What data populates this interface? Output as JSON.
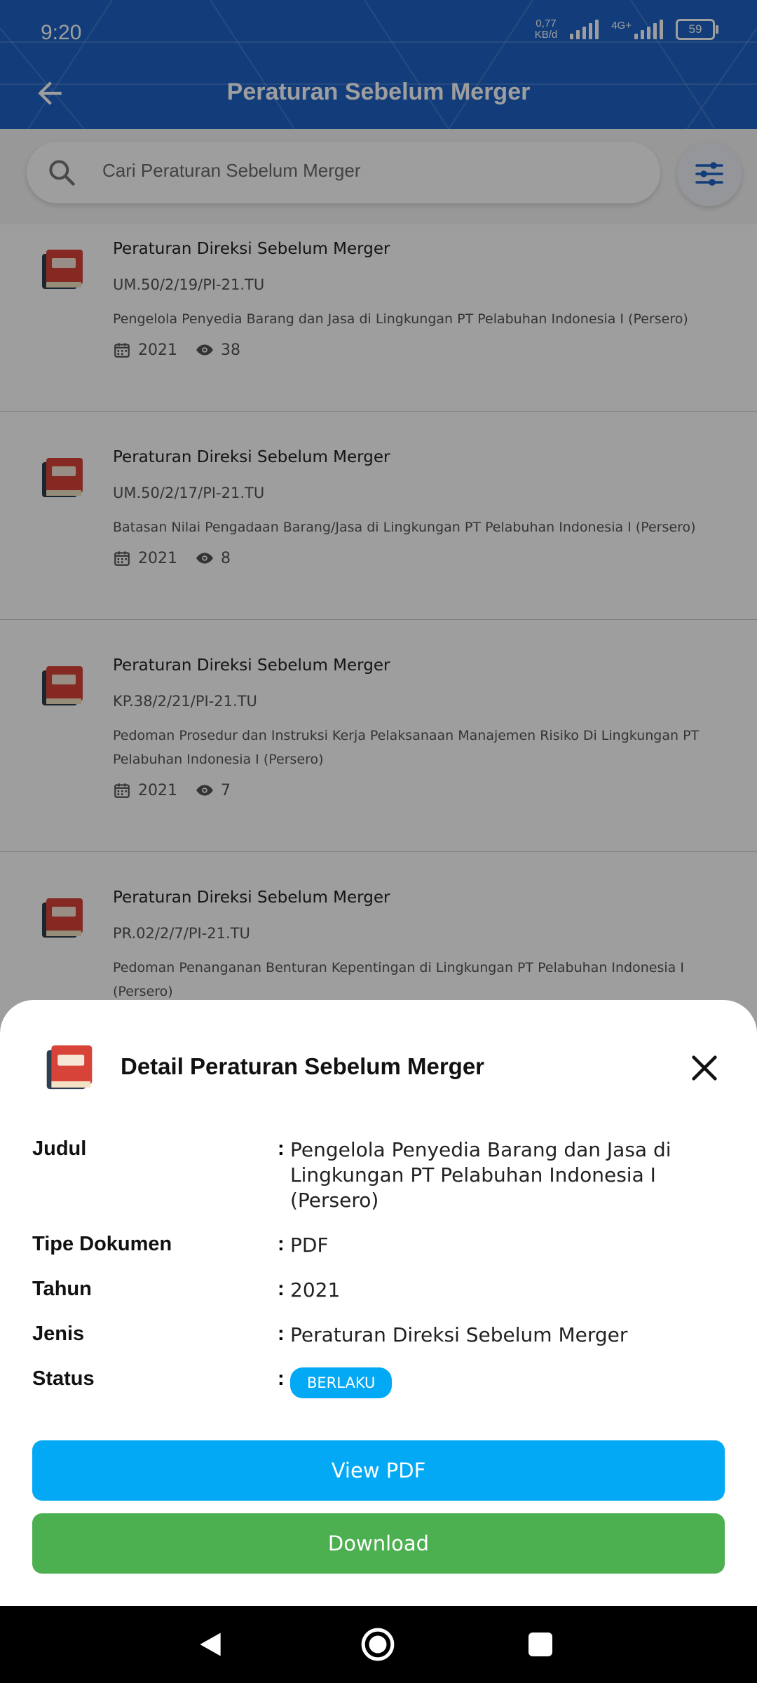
{
  "status": {
    "time": "9:20",
    "net_speed_top": "0,77",
    "net_speed_bottom": "KB/d",
    "network": "4G+",
    "battery": "59"
  },
  "app": {
    "title": "Peraturan Sebelum Merger"
  },
  "search": {
    "placeholder": "Cari Peraturan Sebelum Merger"
  },
  "items": [
    {
      "title": "Peraturan Direksi Sebelum Merger",
      "code": "UM.50/2/19/PI-21.TU",
      "desc": "Pengelola Penyedia Barang dan Jasa di Lingkungan PT Pelabuhan Indonesia I (Persero)",
      "year": "2021",
      "views": "38"
    },
    {
      "title": "Peraturan Direksi Sebelum Merger",
      "code": "UM.50/2/17/PI-21.TU",
      "desc": "Batasan Nilai Pengadaan Barang/Jasa di Lingkungan PT Pelabuhan Indonesia I (Persero)",
      "year": "2021",
      "views": "8"
    },
    {
      "title": "Peraturan Direksi Sebelum Merger",
      "code": "KP.38/2/21/PI-21.TU",
      "desc": "Pedoman Prosedur dan Instruksi Kerja Pelaksanaan Manajemen Risiko Di Lingkungan PT Pelabuhan Indonesia I (Persero)",
      "year": "2021",
      "views": "7"
    },
    {
      "title": "Peraturan Direksi Sebelum Merger",
      "code": "PR.02/2/7/PI-21.TU",
      "desc": "Pedoman Penanganan Benturan Kepentingan di Lingkungan PT Pelabuhan Indonesia I (Persero)",
      "year": "",
      "views": ""
    }
  ],
  "sheet": {
    "title": "Detail Peraturan Sebelum Merger",
    "rows": [
      {
        "label": "Judul",
        "value": "Pengelola Penyedia Barang dan Jasa di Lingkungan PT Pelabuhan Indonesia I (Persero)"
      },
      {
        "label": "Tipe Dokumen",
        "value": "PDF"
      },
      {
        "label": "Tahun",
        "value": "2021"
      },
      {
        "label": "Jenis",
        "value": "Peraturan Direksi Sebelum Merger"
      },
      {
        "label": "Status",
        "value": "BERLAKU"
      }
    ],
    "colon": ":",
    "view_label": "View PDF",
    "download_label": "Download",
    "badge_color": "#03a9f4"
  },
  "colors": {
    "primary": "#1e63c6",
    "view_button": "#03a9f4",
    "download_button": "#4caf50"
  }
}
